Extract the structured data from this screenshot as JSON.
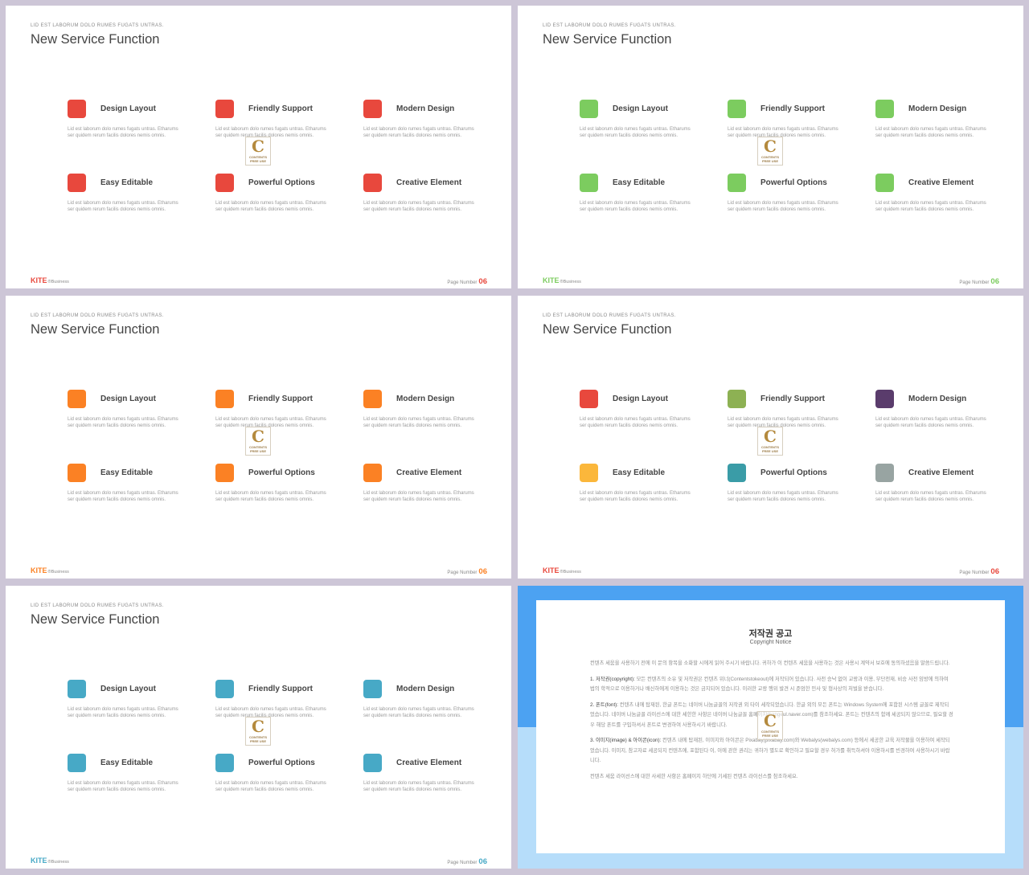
{
  "slides": [
    {
      "kicker": "LID EST LABORUM DOLO RUMES FUGATS UNTRAS.",
      "title": "New Service Function",
      "features": [
        {
          "title": "Design Layout",
          "desc": "Lid est laborum dolo rumes fugats untras. Etharums ser quidem rerum facilis dolores nemis omnis.",
          "color": "#e8483d"
        },
        {
          "title": "Friendly Support",
          "desc": "Lid est laborum dolo rumes fugats untras. Etharums ser quidem rerum facilis dolores nemis omnis.",
          "color": "#e8483d"
        },
        {
          "title": "Modern Design",
          "desc": "Lid est laborum dolo rumes fugats untras. Etharums ser quidem rerum facilis dolores nemis omnis.",
          "color": "#e8483d"
        },
        {
          "title": "Easy Editable",
          "desc": "Lid est laborum dolo rumes fugats untras. Etharums ser quidem rerum facilis dolores nemis omnis.",
          "color": "#e8483d"
        },
        {
          "title": "Powerful Options",
          "desc": "Lid est laborum dolo rumes fugats untras. Etharums ser quidem rerum facilis dolores nemis omnis.",
          "color": "#e8483d"
        },
        {
          "title": "Creative Element",
          "desc": "Lid est laborum dolo rumes fugats untras. Etharums ser quidem rerum facilis dolores nemis omnis.",
          "color": "#e8483d"
        }
      ],
      "brand": "KITE",
      "brand_sub": "®Business",
      "brand_color": "#e8483d",
      "page_label": "Page Number",
      "page_number": "06"
    },
    {
      "kicker": "LID EST LABORUM DOLO RUMES FUGATS UNTRAS.",
      "title": "New Service Function",
      "features": [
        {
          "title": "Design Layout",
          "desc": "Lid est laborum dolo rumes fugats untras. Etharums ser quidem rerum facilis dolores nemis omnis.",
          "color": "#7ccc5f"
        },
        {
          "title": "Friendly Support",
          "desc": "Lid est laborum dolo rumes fugats untras. Etharums ser quidem rerum facilis dolores nemis omnis.",
          "color": "#7ccc5f"
        },
        {
          "title": "Modern Design",
          "desc": "Lid est laborum dolo rumes fugats untras. Etharums ser quidem rerum facilis dolores nemis omnis.",
          "color": "#7ccc5f"
        },
        {
          "title": "Easy Editable",
          "desc": "Lid est laborum dolo rumes fugats untras. Etharums ser quidem rerum facilis dolores nemis omnis.",
          "color": "#7ccc5f"
        },
        {
          "title": "Powerful Options",
          "desc": "Lid est laborum dolo rumes fugats untras. Etharums ser quidem rerum facilis dolores nemis omnis.",
          "color": "#7ccc5f"
        },
        {
          "title": "Creative Element",
          "desc": "Lid est laborum dolo rumes fugats untras. Etharums ser quidem rerum facilis dolores nemis omnis.",
          "color": "#7ccc5f"
        }
      ],
      "brand": "KITE",
      "brand_sub": "®Business",
      "brand_color": "#7ccc5f",
      "page_label": "Page Number",
      "page_number": "06"
    },
    {
      "kicker": "LID EST LABORUM DOLO RUMES FUGATS UNTRAS.",
      "title": "New Service Function",
      "features": [
        {
          "title": "Design Layout",
          "desc": "Lid est laborum dolo rumes fugats untras. Etharums ser quidem rerum facilis dolores nemis omnis.",
          "color": "#fb8124"
        },
        {
          "title": "Friendly Support",
          "desc": "Lid est laborum dolo rumes fugats untras. Etharums ser quidem rerum facilis dolores nemis omnis.",
          "color": "#fb8124"
        },
        {
          "title": "Modern Design",
          "desc": "Lid est laborum dolo rumes fugats untras. Etharums ser quidem rerum facilis dolores nemis omnis.",
          "color": "#fb8124"
        },
        {
          "title": "Easy Editable",
          "desc": "Lid est laborum dolo rumes fugats untras. Etharums ser quidem rerum facilis dolores nemis omnis.",
          "color": "#fb8124"
        },
        {
          "title": "Powerful Options",
          "desc": "Lid est laborum dolo rumes fugats untras. Etharums ser quidem rerum facilis dolores nemis omnis.",
          "color": "#fb8124"
        },
        {
          "title": "Creative Element",
          "desc": "Lid est laborum dolo rumes fugats untras. Etharums ser quidem rerum facilis dolores nemis omnis.",
          "color": "#fb8124"
        }
      ],
      "brand": "KITE",
      "brand_sub": "®Business",
      "brand_color": "#fb8124",
      "page_label": "Page Number",
      "page_number": "06"
    },
    {
      "kicker": "LID EST LABORUM DOLO RUMES FUGATS UNTRAS.",
      "title": "New Service Function",
      "features": [
        {
          "title": "Design Layout",
          "desc": "Lid est laborum dolo rumes fugats untras. Etharums ser quidem rerum facilis dolores nemis omnis.",
          "color": "#e8483d"
        },
        {
          "title": "Friendly Support",
          "desc": "Lid est laborum dolo rumes fugats untras. Etharums ser quidem rerum facilis dolores nemis omnis.",
          "color": "#8db153"
        },
        {
          "title": "Modern Design",
          "desc": "Lid est laborum dolo rumes fugats untras. Etharums ser quidem rerum facilis dolores nemis omnis.",
          "color": "#5a3c6c"
        },
        {
          "title": "Easy Editable",
          "desc": "Lid est laborum dolo rumes fugats untras. Etharums ser quidem rerum facilis dolores nemis omnis.",
          "color": "#fbb73b"
        },
        {
          "title": "Powerful Options",
          "desc": "Lid est laborum dolo rumes fugats untras. Etharums ser quidem rerum facilis dolores nemis omnis.",
          "color": "#3a9ca7"
        },
        {
          "title": "Creative Element",
          "desc": "Lid est laborum dolo rumes fugats untras. Etharums ser quidem rerum facilis dolores nemis omnis.",
          "color": "#98a4a2"
        }
      ],
      "brand": "KITE",
      "brand_sub": "®Business",
      "brand_color": "#e8483d",
      "page_label": "Page Number",
      "page_number": "06"
    },
    {
      "kicker": "LID EST LABORUM DOLO RUMES FUGATS UNTRAS.",
      "title": "New Service Function",
      "features": [
        {
          "title": "Design Layout",
          "desc": "Lid est laborum dolo rumes fugats untras. Etharums ser quidem rerum facilis dolores nemis omnis.",
          "color": "#47a9c6"
        },
        {
          "title": "Friendly Support",
          "desc": "Lid est laborum dolo rumes fugats untras. Etharums ser quidem rerum facilis dolores nemis omnis.",
          "color": "#47a9c6"
        },
        {
          "title": "Modern Design",
          "desc": "Lid est laborum dolo rumes fugats untras. Etharums ser quidem rerum facilis dolores nemis omnis.",
          "color": "#47a9c6"
        },
        {
          "title": "Easy Editable",
          "desc": "Lid est laborum dolo rumes fugats untras. Etharums ser quidem rerum facilis dolores nemis omnis.",
          "color": "#47a9c6"
        },
        {
          "title": "Powerful Options",
          "desc": "Lid est laborum dolo rumes fugats untras. Etharums ser quidem rerum facilis dolores nemis omnis.",
          "color": "#47a9c6"
        },
        {
          "title": "Creative Element",
          "desc": "Lid est laborum dolo rumes fugats untras. Etharums ser quidem rerum facilis dolores nemis omnis.",
          "color": "#47a9c6"
        }
      ],
      "brand": "KITE",
      "brand_sub": "®Business",
      "brand_color": "#47a9c6",
      "page_label": "Page Number",
      "page_number": "06"
    }
  ],
  "watermark": {
    "letter": "C",
    "text1": "CONTENTS",
    "text2": "FREE USE"
  },
  "copyright": {
    "title": "저작권 공고",
    "subtitle": "Copyright Notice",
    "intro": "컨텐츠 세움을 사용하기 전에 이 문의 항목을 소화할 시에게 읽어 주시기 바랍니다. 귀하가 이 컨텐츠 세움을 사용하는 것은 사용시 계약서 보호에 동의하셨음을 말씀드립니다.",
    "sections": [
      {
        "heading": "1. 저작권(copyright):",
        "text": " 모든 컨텐츠의 소유 및 저작권은 컨텐츠 위너(Contentstokeout)에 저작되어 있습니다. 사전 승낙 없이 교랑과 이용, 무단전재, 비승 사전 임방에 의하여 법의 학적으로 이용하거나 배신하에게 이용하는 것은 금지되어 있습니다. 이러한 교랑 행위 발견 시 준엄한 민사 및 형사상의 처벌을 받습니다."
      },
      {
        "heading": "2. 폰트(font):",
        "text": " 컨텐츠 내에 탑재된, 한글 폰트는 네이버 나눔글꼴의 저작권 외 타이 세작되었습니다. 한글 외의 모든 폰트는 Windows System에 포함된 시스템 글꼴로 제작되었습니다. 네이버 나눔글꼴 라이선스에 대한 세한한 사항은 네이버 나눔글꼴 홈페이지(hangeul.naver.com)를 참조하세요. 폰트는 컨텐츠의 함께 세공되지 않으므로, 필요할 경우 해당 폰트를 구입하셔서 폰트로 변경하여 사용하시기 바랍니다."
      },
      {
        "heading": "3. 이미지(image) & 아이콘(icon):",
        "text": " 컨텐츠 내에 탑재된, 이미지와 아이콘은 Pixabay(pixabay.com)와 Webalys(webalys.com) 등에서 세공한 교육 저작물을 이용하여 세작되었습니다. 이미지, 참고자료 세공되지 컨텐츠에, 포함된다 이, 이에 관한 권리는 귀하가 별도로 확인하고 필요할 경우 허가를 취득하셔야 이용하시를 빈경하여 사용하시기 바랍니다."
      }
    ],
    "outro": "컨텐츠 세움 라이선스에 대한 사세한 사항은 홈페이지 하단에 기세된 컨텐츠 라이선스를 참조하세요."
  }
}
